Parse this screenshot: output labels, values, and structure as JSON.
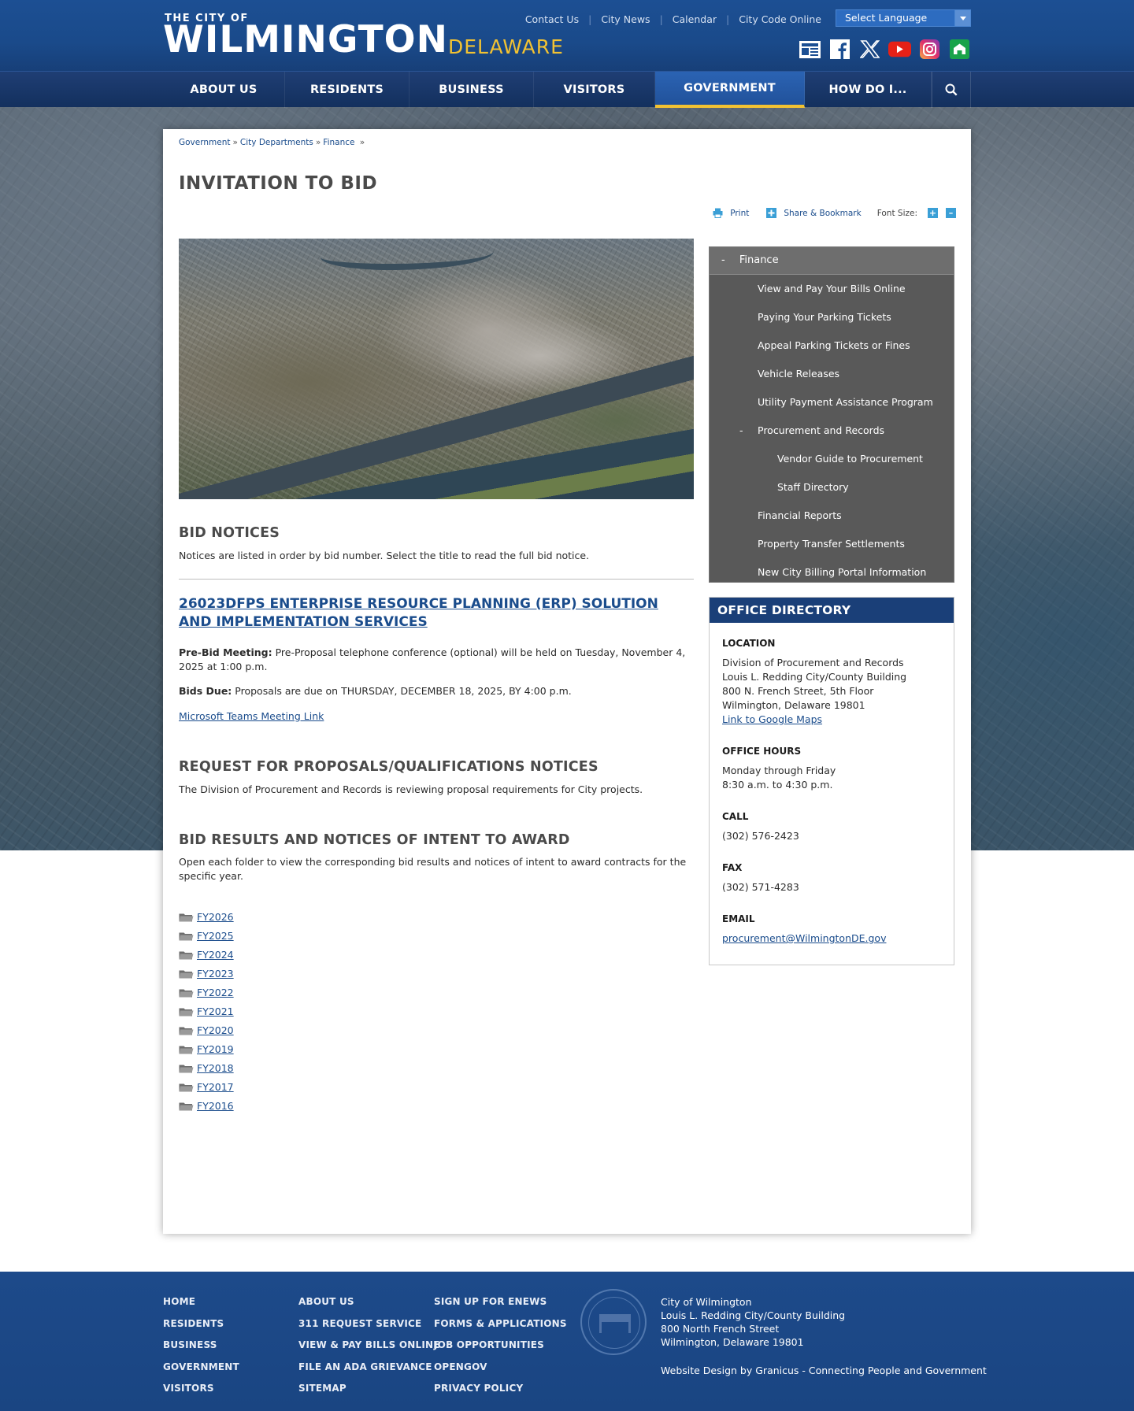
{
  "header": {
    "logo_top": "THE CITY OF",
    "logo_main": "WILMINGTON",
    "logo_state": "DELAWARE",
    "utility_links": [
      "Contact Us",
      "City News",
      "Calendar",
      "City Code Online"
    ],
    "language_select": "Select Language",
    "social_icons": [
      "news-icon",
      "facebook-icon",
      "x-icon",
      "youtube-icon",
      "instagram-icon",
      "nextdoor-icon"
    ]
  },
  "nav": {
    "items": [
      "ABOUT US",
      "RESIDENTS",
      "BUSINESS",
      "VISITORS",
      "GOVERNMENT",
      "HOW DO I..."
    ],
    "active": "GOVERNMENT"
  },
  "breadcrumb": [
    "Government",
    "City Departments",
    "Finance"
  ],
  "page": {
    "title": "INVITATION TO BID",
    "tools": {
      "print": "Print",
      "share": "Share & Bookmark",
      "font_size": "Font Size:"
    }
  },
  "bid_notices": {
    "heading": "BID NOTICES",
    "intro": "Notices are listed in order by bid number. Select the title to read the full bid notice.",
    "bid_title": "26023DFPS ENTERPRISE RESOURCE PLANNING (ERP) SOLUTION AND IMPLEMENTATION SERVICES",
    "prebid_label": "Pre-Bid Meeting:",
    "prebid_text": " Pre-Proposal telephone conference (optional) will be held on Tuesday, November 4, 2025 at 1:00 p.m.",
    "due_label": "Bids Due:",
    "due_text": " Proposals are due on THURSDAY, DECEMBER 18, 2025, BY 4:00 p.m.",
    "teams_link": "Microsoft Teams Meeting Link"
  },
  "rfp": {
    "heading": "REQUEST FOR PROPOSALS/QUALIFICATIONS NOTICES",
    "text": "The Division of Procurement and Records is reviewing proposal requirements for City projects."
  },
  "results": {
    "heading": "BID RESULTS AND NOTICES OF INTENT TO AWARD",
    "text": "Open each folder to view the corresponding bid results and notices of intent to award contracts for the specific year.",
    "folders": [
      "FY2026",
      "FY2025",
      "FY2024",
      "FY2023",
      "FY2022",
      "FY2021",
      "FY2020",
      "FY2019",
      "FY2018",
      "FY2017",
      "FY2016"
    ]
  },
  "sidenav": {
    "head_toggle": "-",
    "head": "Finance",
    "items": [
      {
        "label": "View and Pay Your Bills Online",
        "level": 1,
        "toggle": ""
      },
      {
        "label": "Paying Your Parking Tickets",
        "level": 1,
        "toggle": ""
      },
      {
        "label": "Appeal Parking Tickets or Fines",
        "level": 1,
        "toggle": ""
      },
      {
        "label": "Vehicle Releases",
        "level": 1,
        "toggle": ""
      },
      {
        "label": "Utility Payment Assistance Program",
        "level": 1,
        "toggle": ""
      },
      {
        "label": "Procurement and Records",
        "level": 1,
        "toggle": "-"
      },
      {
        "label": "Vendor Guide to Procurement",
        "level": 2,
        "toggle": ""
      },
      {
        "label": "Staff Directory",
        "level": 2,
        "toggle": ""
      },
      {
        "label": "Financial Reports",
        "level": 1,
        "toggle": ""
      },
      {
        "label": "Property Transfer Settlements",
        "level": 1,
        "toggle": ""
      },
      {
        "label": "New City Billing Portal Information",
        "level": 1,
        "toggle": ""
      }
    ]
  },
  "office_directory": {
    "heading": "OFFICE DIRECTORY",
    "location_label": "LOCATION",
    "location_lines": [
      "Division of Procurement and Records",
      "Louis L. Redding City/County Building",
      "800 N. French Street, 5th Floor",
      "Wilmington, Delaware 19801"
    ],
    "maps_link": "Link to Google Maps",
    "hours_label": "OFFICE HOURS",
    "hours_lines": [
      "Monday through Friday",
      "8:30 a.m. to 4:30 p.m."
    ],
    "call_label": "CALL",
    "call": "(302) 576-2423",
    "fax_label": "FAX",
    "fax": "(302) 571-4283",
    "email_label": "EMAIL",
    "email": "procurement@WilmingtonDE.gov"
  },
  "footer": {
    "col1": [
      "HOME",
      "RESIDENTS",
      "BUSINESS",
      "GOVERNMENT",
      "VISITORS"
    ],
    "col2": [
      "ABOUT US",
      "311 REQUEST SERVICE",
      "VIEW & PAY BILLS ONLINE",
      "FILE AN ADA GRIEVANCE",
      "SITEMAP"
    ],
    "col3": [
      "SIGN UP FOR ENEWS",
      "FORMS & APPLICATIONS",
      "JOB OPPORTUNITIES",
      "OPENGOV",
      "PRIVACY POLICY"
    ],
    "address": [
      "City of Wilmington",
      "Louis L. Redding City/County Building",
      "800 North French Street",
      "Wilmington, Delaware 19801"
    ],
    "credit": "Website Design by Granicus - Connecting People and Government"
  },
  "colors": {
    "header_blue": "#1c4f93",
    "nav_blue": "#13305e",
    "accent_gold": "#f2c232",
    "link_blue": "#1a4c8c",
    "sidenav_gray": "#595959"
  }
}
